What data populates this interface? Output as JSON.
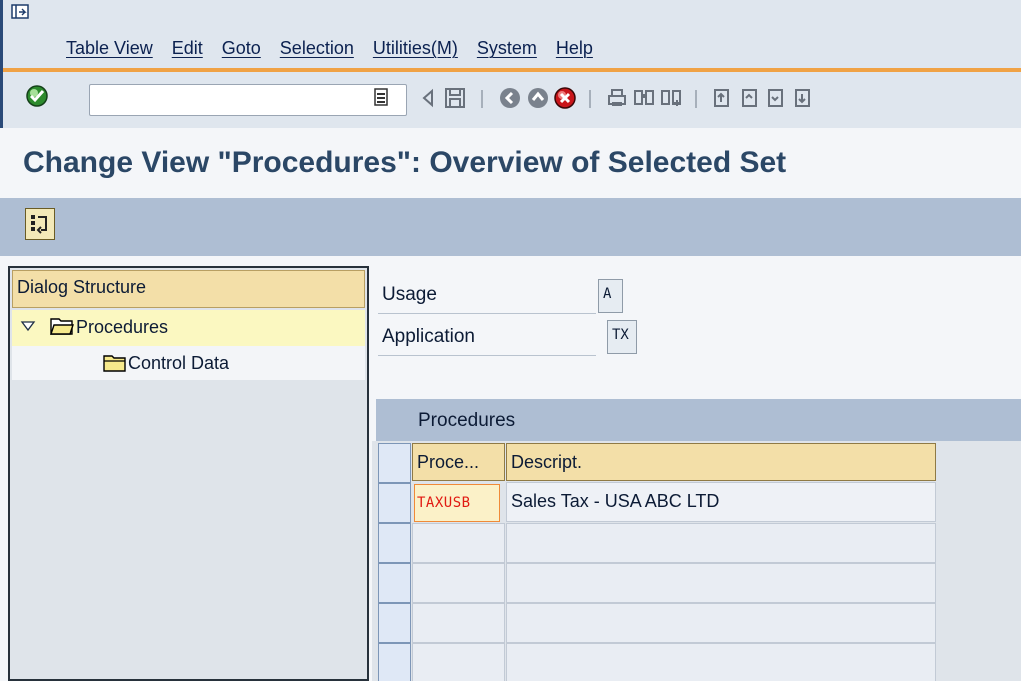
{
  "menu": {
    "items": [
      {
        "label": "Table View"
      },
      {
        "label": "Edit"
      },
      {
        "label": "Goto"
      },
      {
        "label": "Selection"
      },
      {
        "label": "Utilities(M)"
      },
      {
        "label": "System"
      },
      {
        "label": "Help"
      }
    ]
  },
  "toolbar": {
    "command_value": "",
    "icons": [
      "ok-checkmark-icon",
      "command-history-icon",
      "back-triangle-icon",
      "save-icon",
      "back-icon",
      "exit-icon",
      "cancel-icon",
      "print-icon",
      "find-icon",
      "find-next-icon",
      "first-page-icon",
      "previous-page-icon",
      "next-page-icon",
      "last-page-icon"
    ]
  },
  "title": "Change View \"Procedures\": Overview of Selected Set",
  "app_toolbar": {
    "icons": [
      "dialog-structure-toggle-icon"
    ]
  },
  "dialog_structure": {
    "header": "Dialog Structure",
    "items": [
      {
        "label": "Procedures",
        "expanded": true,
        "icon": "folder-open-icon"
      },
      {
        "label": "Control Data",
        "icon": "folder-closed-icon"
      }
    ]
  },
  "fields": {
    "usage": {
      "label": "Usage",
      "value": "A"
    },
    "application": {
      "label": "Application",
      "value": "TX"
    }
  },
  "table": {
    "title": "Procedures",
    "columns": [
      "Proce...",
      "Descript."
    ],
    "rows": [
      {
        "procedure": "TAXUSB",
        "description": "Sales Tax - USA ABC LTD"
      }
    ]
  },
  "colors": {
    "brand_dark": "#2a4a78",
    "accent_orange": "#f0a245",
    "header_yellow": "#f3dfa8",
    "highlight_yellow": "#fbf8c1",
    "title_text": "#2b4766"
  }
}
